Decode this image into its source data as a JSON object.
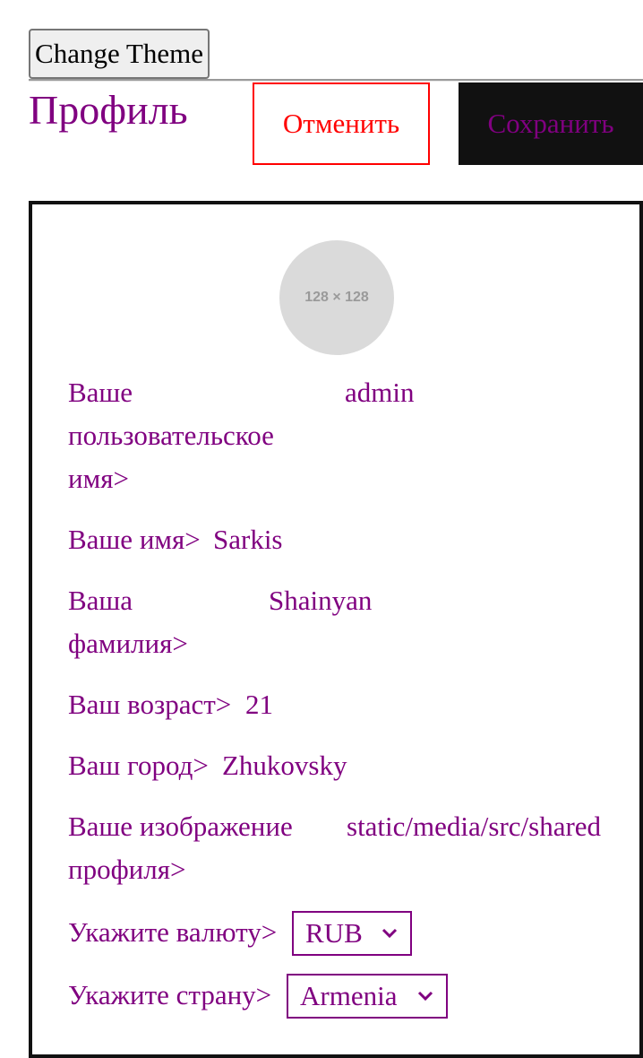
{
  "toolbar": {
    "change_theme_label": "Change Theme"
  },
  "header": {
    "title": "Профиль",
    "cancel_label": "Отменить",
    "save_label": "Сохранить"
  },
  "profile": {
    "avatar_placeholder": "128 × 128",
    "fields": {
      "username": {
        "label": "Ваше пользовательское имя>",
        "value": "admin"
      },
      "first_name": {
        "label": "Ваше имя>",
        "value": "Sarkis"
      },
      "last_name": {
        "label": "Ваша фамилия>",
        "value": "Shainyan"
      },
      "age": {
        "label": "Ваш возраст>",
        "value": "21"
      },
      "city": {
        "label": "Ваш город>",
        "value": "Zhukovsky"
      },
      "image": {
        "label": "Ваше изображение профиля>",
        "value": "static/media/src/shared"
      }
    },
    "currency": {
      "label": "Укажите валюту>",
      "selected": "RUB"
    },
    "country": {
      "label": "Укажите страну>",
      "selected": "Armenia"
    }
  },
  "colors": {
    "text": "#800080",
    "cancel": "#ff0000",
    "save_bg": "#111111",
    "avatar_bg": "#dadada"
  }
}
